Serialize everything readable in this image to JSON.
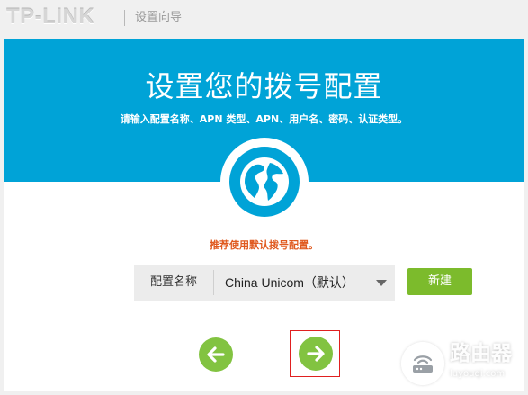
{
  "header": {
    "brand": "TP-LINK",
    "breadcrumb": "设置向导"
  },
  "hero": {
    "title": "设置您的拨号配置",
    "subtitle": "请输入配置名称、APN 类型、APN、用户名、密码、认证类型。",
    "icon": "globe-icon"
  },
  "form": {
    "hint": "推荐使用默认拨号配置。",
    "profile_label": "配置名称",
    "profile_value": "China Unicom（默认）",
    "new_button": "新建"
  },
  "nav": {
    "prev_icon": "arrow-left-icon",
    "next_icon": "arrow-right-icon"
  },
  "watermark": {
    "text": "路由器",
    "url": "luyouqi.com"
  },
  "colors": {
    "hero_bg": "#00a3d7",
    "accent_green": "#7cbb2c",
    "hint_orange": "#e05a1f",
    "focus_red": "#e02020"
  }
}
